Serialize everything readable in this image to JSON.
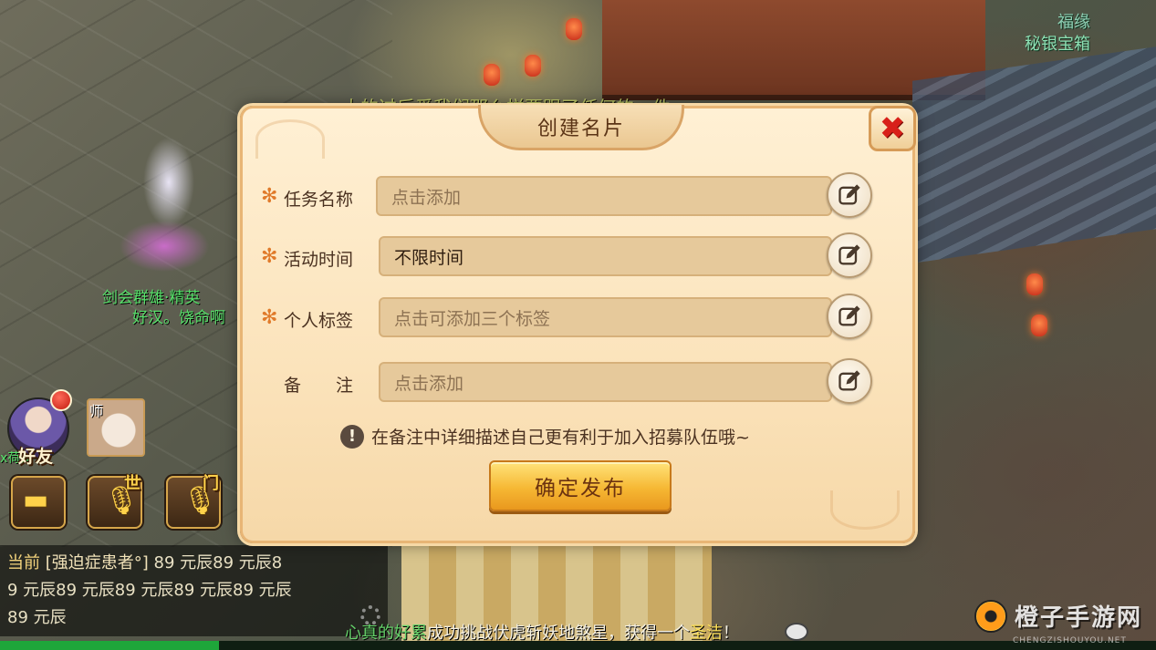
{
  "dialog": {
    "title": "创建名片",
    "fields": [
      {
        "label": "任务名称",
        "value": "",
        "placeholder": "点击添加",
        "required": true
      },
      {
        "label": "活动时间",
        "value": "不限时间",
        "placeholder": "",
        "required": true
      },
      {
        "label": "个人标签",
        "value": "",
        "placeholder": "点击可添加三个标签",
        "required": true
      },
      {
        "label": "备　　注",
        "value": "",
        "placeholder": "点击添加",
        "required": false
      }
    ],
    "required_mark": "✻",
    "hint_icon": "!",
    "hint": "在备注中详细描述自己更有利于加入招募队伍哦~",
    "publish_label": "确定发布",
    "close_glyph": "✖"
  },
  "hud": {
    "friend_label": "好友",
    "master_label": "师",
    "world_channel": "世",
    "sect_channel": "门"
  },
  "scene": {
    "top_right_name": "福缘",
    "top_right_sub": "秘银宝箱",
    "npc_line1": "剑会群雄·精英",
    "npc_line2": "好汉。饶命啊",
    "partial_name": "x荷荷",
    "banner": "大的过后爱我们那么样要跟了任何的一件"
  },
  "chat": {
    "lines": [
      {
        "tag": "当前",
        "name": "[强迫症患者°]",
        "text": "89 元辰89 元辰8"
      },
      {
        "tag": "",
        "name": "",
        "text": "9 元辰89 元辰89 元辰89 元辰89 元辰"
      },
      {
        "tag": "",
        "name": "",
        "text": "89 元辰"
      }
    ]
  },
  "system_message": {
    "player": "心真的好累",
    "text": "成功挑战伏虎斩妖地煞星，获得一个",
    "item": "圣洁",
    "end": "！"
  },
  "watermark": {
    "title": "橙子手游网",
    "domain": "CHENGZISHOUYOU.NET"
  },
  "colors": {
    "accent": "#f6b834",
    "dialog_bg": "#fbe3bb",
    "field_bg": "#e6c99b",
    "close_red": "#d8201a",
    "required_orange": "#e07a2a"
  }
}
